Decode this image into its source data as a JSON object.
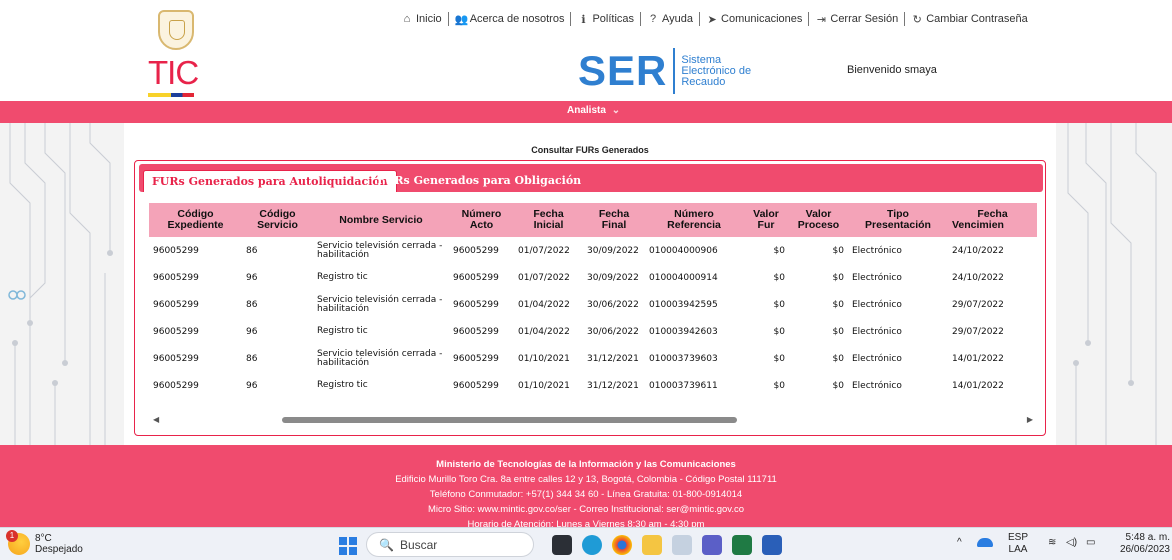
{
  "logo": {
    "text": "TIC"
  },
  "topnav": [
    {
      "icon": "home-icon",
      "glyph": "⌂",
      "label": "Inicio"
    },
    {
      "icon": "users-icon",
      "glyph": "👥",
      "label": "Acerca de nosotros"
    },
    {
      "icon": "info-icon",
      "glyph": "ℹ",
      "label": "Políticas"
    },
    {
      "icon": "help-icon",
      "glyph": "?",
      "label": "Ayuda"
    },
    {
      "icon": "send-icon",
      "glyph": "➤",
      "label": "Comunicaciones"
    },
    {
      "icon": "logout-icon",
      "glyph": "⇥",
      "label": "Cerrar Sesión"
    },
    {
      "icon": "refresh-icon",
      "glyph": "↻",
      "label": "Cambiar Contraseña"
    }
  ],
  "brand": {
    "ser": "SER",
    "line1": "Sistema",
    "line2": "Electrónico de",
    "line3": "Recaudo"
  },
  "welcome": "Bienvenido smaya",
  "menubar": {
    "role": "Analista",
    "chevron": "⌄"
  },
  "page": {
    "title": "Consultar FURs Generados"
  },
  "tabs": [
    {
      "label": "FURs Generados para Autoliquidación"
    },
    {
      "label": "FURs Generados para Obligación"
    }
  ],
  "table": {
    "headers": [
      [
        "Código",
        "Expediente"
      ],
      [
        "Código",
        "Servicio"
      ],
      [
        "Nombre Servicio",
        ""
      ],
      [
        "Número",
        "Acto"
      ],
      [
        "Fecha",
        "Inicial"
      ],
      [
        "Fecha",
        "Final"
      ],
      [
        "Número",
        "Referencia"
      ],
      [
        "Valor",
        "Fur"
      ],
      [
        "Valor",
        "Proceso"
      ],
      [
        "Tipo",
        "Presentación"
      ],
      [
        "Fecha",
        "Vencimien"
      ]
    ],
    "rows": [
      [
        "96005299",
        "86",
        "Servicio televisión cerrada - habilitación",
        "96005299",
        "01/07/2022",
        "30/09/2022",
        "010004000906",
        "$0",
        "$0",
        "Electrónico",
        "24/10/2022"
      ],
      [
        "96005299",
        "96",
        "Registro tic",
        "96005299",
        "01/07/2022",
        "30/09/2022",
        "010004000914",
        "$0",
        "$0",
        "Electrónico",
        "24/10/2022"
      ],
      [
        "96005299",
        "86",
        "Servicio televisión cerrada - habilitación",
        "96005299",
        "01/04/2022",
        "30/06/2022",
        "010003942595",
        "$0",
        "$0",
        "Electrónico",
        "29/07/2022"
      ],
      [
        "96005299",
        "96",
        "Registro tic",
        "96005299",
        "01/04/2022",
        "30/06/2022",
        "010003942603",
        "$0",
        "$0",
        "Electrónico",
        "29/07/2022"
      ],
      [
        "96005299",
        "86",
        "Servicio televisión cerrada - habilitación",
        "96005299",
        "01/10/2021",
        "31/12/2021",
        "010003739603",
        "$0",
        "$0",
        "Electrónico",
        "14/01/2022"
      ],
      [
        "96005299",
        "96",
        "Registro tic",
        "96005299",
        "01/10/2021",
        "31/12/2021",
        "010003739611",
        "$0",
        "$0",
        "Electrónico",
        "14/01/2022"
      ]
    ]
  },
  "footer": [
    "Ministerio de Tecnologías de la Información y las Comunicaciones",
    "Edificio Murillo Toro Cra. 8a entre calles 12 y 13, Bogotá, Colombia - Código Postal 111711",
    "Teléfono Conmutador: +57(1) 344 34 60 - Línea Gratuita: 01-800-0914014",
    "Micro Sitio: www.mintic.gov.co/ser - Correo Institucional: ser@mintic.gov.co",
    "Horario de Atención: Lunes a Viernes 8:30 am - 4:30 pm"
  ],
  "taskbar": {
    "weather_temp": "8°C",
    "weather_desc": "Despejado",
    "weather_badge": "1",
    "search_placeholder": "Buscar",
    "lang1": "ESP",
    "lang2": "LAA",
    "time": "5:48 a. m.",
    "date": "26/06/2023",
    "tray_up": "^"
  },
  "colors": {
    "accent": "#f04b6e",
    "header_row": "#f4a3b8",
    "brand_blue": "#2f7fd0"
  }
}
